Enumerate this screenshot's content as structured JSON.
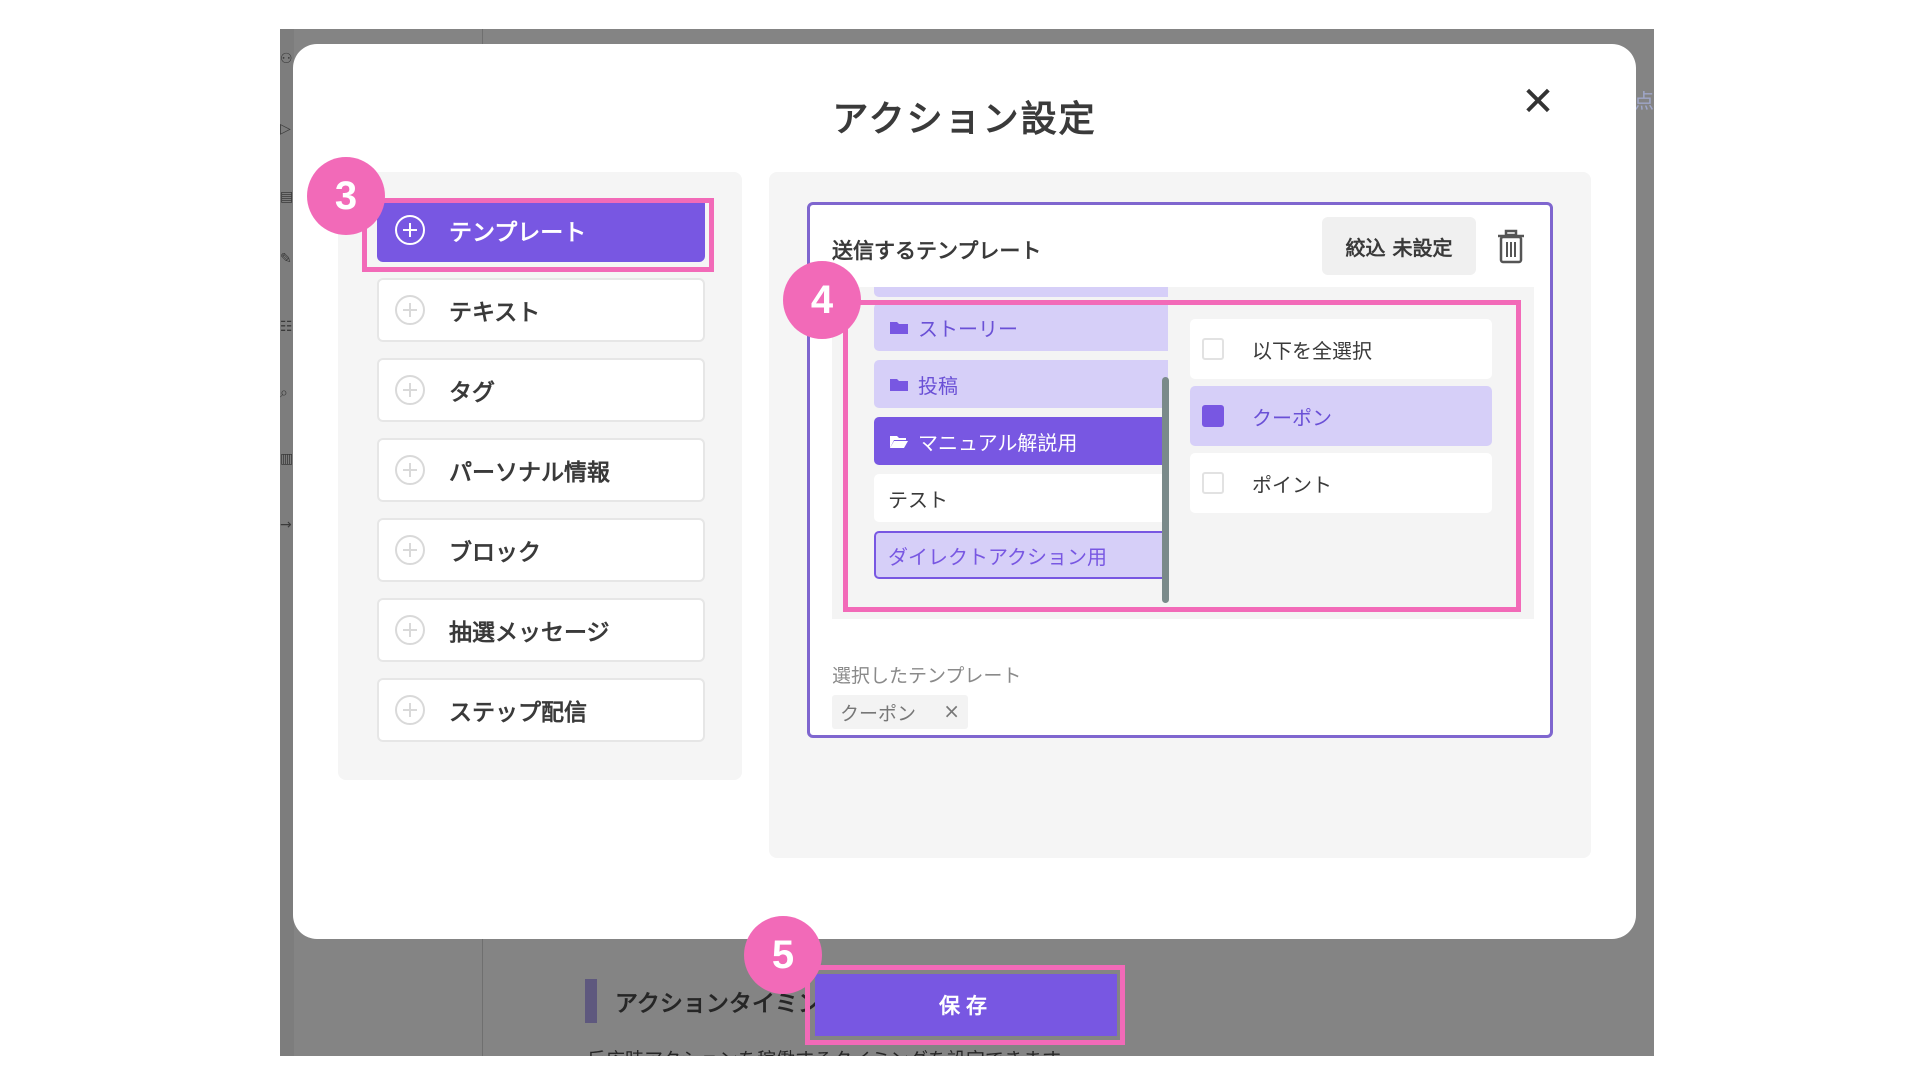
{
  "background": {
    "section_title": "アクションタイミング",
    "section_desc": "反応時アクションを稼働するタイミングを設定できます",
    "right_text": "点"
  },
  "modal": {
    "title": "アクション設定",
    "close_glyph": "✕",
    "actions": [
      {
        "label": "テンプレート",
        "active": true
      },
      {
        "label": "テキスト",
        "active": false
      },
      {
        "label": "タグ",
        "active": false
      },
      {
        "label": "パーソナル情報",
        "active": false
      },
      {
        "label": "ブロック",
        "active": false
      },
      {
        "label": "抽選メッセージ",
        "active": false
      },
      {
        "label": "ステップ配信",
        "active": false
      }
    ],
    "template_panel": {
      "title": "送信するテンプレート",
      "filter_label": "絞込 未設定",
      "folders": [
        {
          "label": "ストーリー",
          "style": "light",
          "icon": "folder-icon"
        },
        {
          "label": "投稿",
          "style": "light",
          "icon": "folder-icon"
        },
        {
          "label": "マニュアル解説用",
          "style": "dark",
          "icon": "folder-open-icon"
        },
        {
          "label": "テスト",
          "style": "white",
          "icon": ""
        },
        {
          "label": "ダイレクトアクション用",
          "style": "outline",
          "icon": ""
        }
      ],
      "options": [
        {
          "label": "以下を全選択",
          "checked": false
        },
        {
          "label": "クーポン",
          "checked": true
        },
        {
          "label": "ポイント",
          "checked": false
        }
      ],
      "selected_label": "選択したテンプレート",
      "selected_chip": "クーポン",
      "chip_remove": "×"
    },
    "save_label": "保存"
  },
  "annotations": {
    "step3": "3",
    "step4": "4",
    "step5": "5",
    "color": "#f26ab8"
  },
  "colors": {
    "accent": "#7857e2",
    "accent_light": "#d6cff8",
    "overlay": "#848484"
  }
}
